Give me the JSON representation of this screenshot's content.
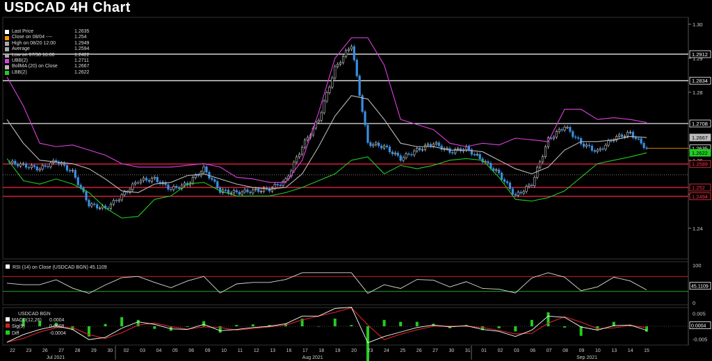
{
  "page": {
    "title": "USDCAD 4H Chart"
  },
  "legend": [
    {
      "label": "Last Price",
      "value": "1.2635",
      "color": "#ffffff"
    },
    {
      "label": "Close on 08/04 ----",
      "value": "1.254",
      "color": "#ff9900"
    },
    {
      "label": "High on 08/20 12:00",
      "value": "1.2949",
      "color": "#aaaaaa"
    },
    {
      "label": "Average",
      "value": "1.2594",
      "color": "#aaaaaa"
    },
    {
      "label": "Low on 07/30 16:00",
      "value": "1.2422",
      "color": "#aaaaaa"
    },
    {
      "label": "UBB(2)",
      "value": "1.2711",
      "color": "#e040e0"
    },
    {
      "label": "BollMA (20) on Close",
      "value": "1.2667",
      "color": "#bbbbbb"
    },
    {
      "label": "LBB(2)",
      "value": "1.2622",
      "color": "#22cc22"
    }
  ],
  "price_axis": {
    "ticks": [
      "1.30",
      "1.29",
      "1.28",
      "1.26",
      "1.25",
      "1.24"
    ],
    "tags": [
      {
        "text": "1.2912",
        "bg": "#000000",
        "fg": "#ffffff",
        "border": "#ffffff",
        "value": 1.2912
      },
      {
        "text": "1.2834",
        "bg": "#000000",
        "fg": "#ffffff",
        "border": "#ffffff",
        "value": 1.2834
      },
      {
        "text": "1.2708",
        "bg": "#000000",
        "fg": "#ffffff",
        "border": "#ffffff",
        "value": 1.2708
      },
      {
        "text": "1.2667",
        "bg": "#bbbbbb",
        "fg": "#000000",
        "border": "#bbbbbb",
        "value": 1.2667
      },
      {
        "text": "1.2635",
        "bg": "#000000",
        "fg": "#ffffff",
        "border": "#ffffff",
        "value": 1.2635
      },
      {
        "text": "1.2622",
        "bg": "#22cc22",
        "fg": "#000000",
        "border": "#22cc22",
        "value": 1.2622
      },
      {
        "text": "1.2589",
        "bg": "#000000",
        "fg": "#ff3344",
        "border": "#ff3344",
        "value": 1.2589
      },
      {
        "text": "1.252",
        "bg": "#000000",
        "fg": "#ff3344",
        "border": "#ff3344",
        "value": 1.252
      },
      {
        "text": "1.2494",
        "bg": "#000000",
        "fg": "#ff3344",
        "border": "#ff3344",
        "value": 1.2494
      }
    ]
  },
  "rsi": {
    "label": "RSI (14) on Close (USDCAD BGN) 45.1109",
    "ticks": [
      "100",
      "50",
      "0"
    ],
    "tag": "45.1109"
  },
  "macd": {
    "title": "USDCAD BGN",
    "items": [
      {
        "label": "MACD(12,26)",
        "value": "0.0004",
        "color": "#ffffff"
      },
      {
        "label": "Sig(9)",
        "value": "0.0008",
        "color": "#cc2222"
      },
      {
        "label": "Diff",
        "value": "-0.0004",
        "color": "#22cc22"
      }
    ],
    "ticks": [
      "0.005",
      "0",
      "-0.005"
    ],
    "tag": "0.0004"
  },
  "date_axis": {
    "days": [
      "22",
      "23",
      "26",
      "27",
      "28",
      "29",
      "30",
      "02",
      "03",
      "04",
      "05",
      "06",
      "09",
      "10",
      "11",
      "12",
      "13",
      "16",
      "17",
      "18",
      "19",
      "20",
      "23",
      "24",
      "25",
      "26",
      "27",
      "30",
      "31",
      "01",
      "02",
      "03",
      "06",
      "07",
      "08",
      "09",
      "10",
      "13",
      "14",
      "15"
    ],
    "months": [
      {
        "label": "Jul 2021",
        "pos": 0.077
      },
      {
        "label": "Aug 2021",
        "pos": 0.452
      },
      {
        "label": "Sep 2021",
        "pos": 0.852
      }
    ]
  },
  "chart_data": {
    "type": "line",
    "title": "USDCAD 4H Chart",
    "x": [
      "22",
      "23",
      "26",
      "27",
      "28",
      "29",
      "30",
      "02",
      "03",
      "04",
      "05",
      "06",
      "09",
      "10",
      "11",
      "12",
      "13",
      "16",
      "17",
      "18",
      "19",
      "20",
      "23",
      "24",
      "25",
      "26",
      "27",
      "30",
      "31",
      "01",
      "02",
      "03",
      "06",
      "07",
      "08",
      "09",
      "10",
      "13",
      "14",
      "15"
    ],
    "ylim": [
      1.232,
      1.301
    ],
    "series": [
      {
        "name": "Last Price",
        "values": [
          1.2595,
          1.2585,
          1.2575,
          1.2598,
          1.2565,
          1.247,
          1.2458,
          1.2495,
          1.254,
          1.2545,
          1.2515,
          1.253,
          1.2575,
          1.251,
          1.2505,
          1.251,
          1.2515,
          1.254,
          1.264,
          1.272,
          1.287,
          1.294,
          1.265,
          1.264,
          1.2605,
          1.263,
          1.265,
          1.2625,
          1.2635,
          1.26,
          1.256,
          1.2495,
          1.253,
          1.266,
          1.27,
          1.265,
          1.2625,
          1.2665,
          1.268,
          1.2635
        ]
      },
      {
        "name": "UBB(2)",
        "values": [
          1.2845,
          1.276,
          1.265,
          1.264,
          1.2645,
          1.263,
          1.2615,
          1.259,
          1.258,
          1.258,
          1.258,
          1.2585,
          1.259,
          1.258,
          1.255,
          1.2545,
          1.2535,
          1.2535,
          1.26,
          1.274,
          1.29,
          1.296,
          1.296,
          1.288,
          1.272,
          1.2705,
          1.269,
          1.265,
          1.264,
          1.265,
          1.2645,
          1.2665,
          1.266,
          1.2655,
          1.275,
          1.275,
          1.272,
          1.2725,
          1.272,
          1.2711
        ]
      },
      {
        "name": "BollMA (20) on Close",
        "values": [
          1.272,
          1.265,
          1.26,
          1.2595,
          1.259,
          1.2575,
          1.2545,
          1.251,
          1.2505,
          1.253,
          1.2535,
          1.2555,
          1.256,
          1.2545,
          1.253,
          1.252,
          1.2515,
          1.252,
          1.256,
          1.264,
          1.273,
          1.279,
          1.278,
          1.272,
          1.265,
          1.264,
          1.264,
          1.263,
          1.263,
          1.2625,
          1.26,
          1.2575,
          1.256,
          1.258,
          1.263,
          1.2655,
          1.2655,
          1.266,
          1.267,
          1.2667
        ]
      },
      {
        "name": "LBB(2)",
        "values": [
          1.2605,
          1.254,
          1.253,
          1.2545,
          1.253,
          1.2505,
          1.246,
          1.243,
          1.2435,
          1.2485,
          1.2495,
          1.253,
          1.2535,
          1.251,
          1.2495,
          1.2495,
          1.2495,
          1.2505,
          1.252,
          1.254,
          1.256,
          1.26,
          1.261,
          1.256,
          1.2585,
          1.2575,
          1.2585,
          1.26,
          1.2605,
          1.26,
          1.255,
          1.2485,
          1.248,
          1.249,
          1.251,
          1.255,
          1.259,
          1.26,
          1.261,
          1.2622
        ]
      }
    ],
    "hlines": [
      1.2912,
      1.2834,
      1.2708,
      1.2589,
      1.252,
      1.2494
    ],
    "grid": false,
    "legend": "top-left"
  }
}
